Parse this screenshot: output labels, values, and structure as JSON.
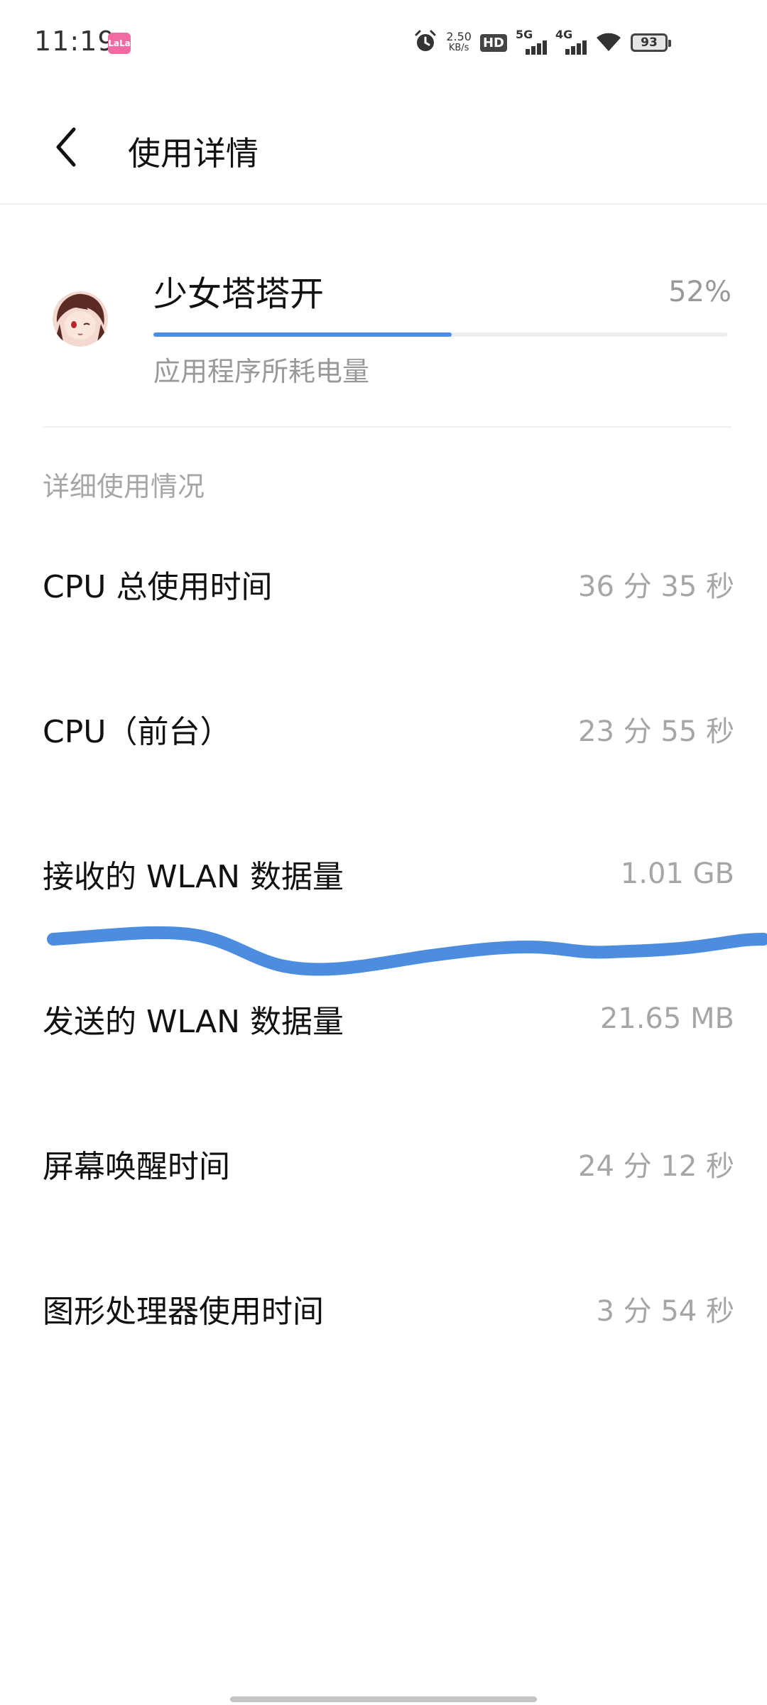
{
  "status_bar": {
    "time": "11:19",
    "app_icon_text": "LaLa",
    "net_speed_value": "2.50",
    "net_speed_unit": "KB/s",
    "hd_label": "HD",
    "sim1_label": "5G",
    "sim2_label": "4G",
    "battery_level": "93"
  },
  "header": {
    "title": "使用详情"
  },
  "app": {
    "name": "少女塔塔开",
    "percent_label": "52%",
    "percent_value": 0.52,
    "subtitle": "应用程序所耗电量",
    "accent_color": "#4c8de0"
  },
  "details": {
    "section_title": "详细使用情况",
    "items": [
      {
        "label": "CPU 总使用时间",
        "value": "36 分 35 秒"
      },
      {
        "label": "CPU（前台）",
        "value": "23 分 55 秒"
      },
      {
        "label": "接收的 WLAN 数据量",
        "value": "1.01 GB"
      },
      {
        "label": "发送的 WLAN 数据量",
        "value": "21.65 MB"
      },
      {
        "label": "屏幕唤醒时间",
        "value": "24 分 12 秒"
      },
      {
        "label": "图形处理器使用时间",
        "value": "3 分 54 秒"
      }
    ]
  },
  "icons": {
    "back": "chevron-left-icon",
    "alarm": "alarm-icon",
    "wifi": "wifi-icon",
    "battery": "battery-icon"
  }
}
